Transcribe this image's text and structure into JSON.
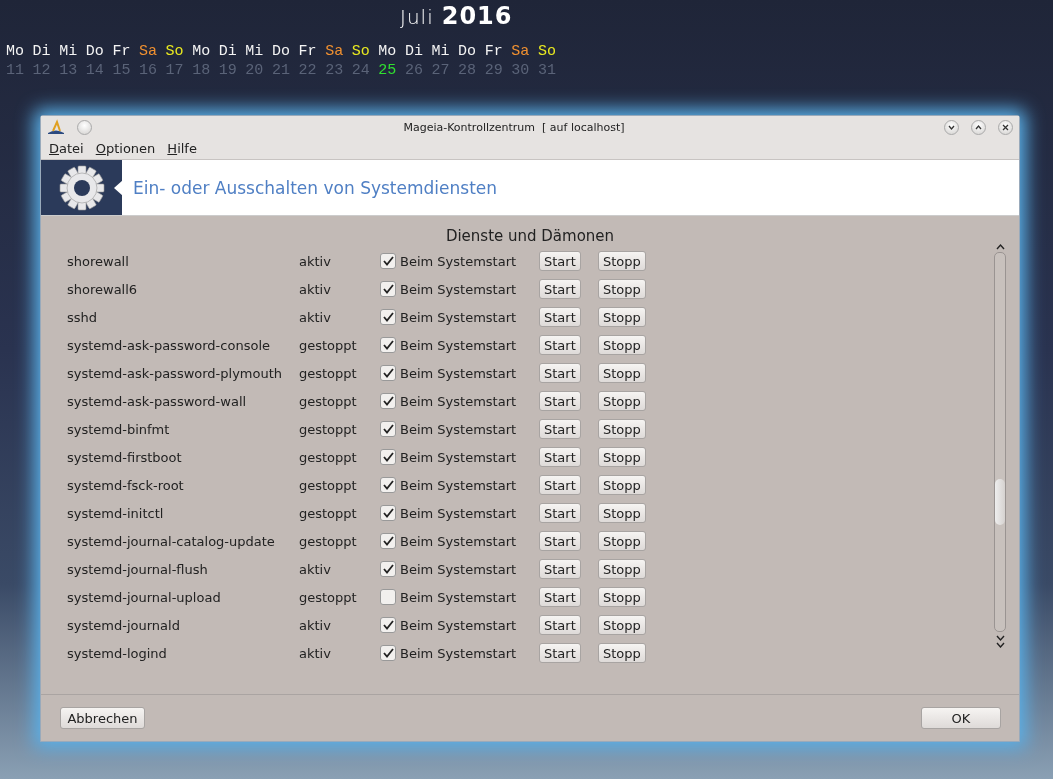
{
  "calendar": {
    "month": "Juli",
    "year": "2016",
    "days": [
      {
        "weekday": "Mo",
        "date": "11",
        "kind": "weekday",
        "today": false
      },
      {
        "weekday": "Di",
        "date": "12",
        "kind": "weekday",
        "today": false
      },
      {
        "weekday": "Mi",
        "date": "13",
        "kind": "weekday",
        "today": false
      },
      {
        "weekday": "Do",
        "date": "14",
        "kind": "weekday",
        "today": false
      },
      {
        "weekday": "Fr",
        "date": "15",
        "kind": "weekday",
        "today": false
      },
      {
        "weekday": "Sa",
        "date": "16",
        "kind": "saturday",
        "today": false
      },
      {
        "weekday": "So",
        "date": "17",
        "kind": "sunday",
        "today": false
      },
      {
        "weekday": "Mo",
        "date": "18",
        "kind": "weekday",
        "today": false
      },
      {
        "weekday": "Di",
        "date": "19",
        "kind": "weekday",
        "today": false
      },
      {
        "weekday": "Mi",
        "date": "20",
        "kind": "weekday",
        "today": false
      },
      {
        "weekday": "Do",
        "date": "21",
        "kind": "weekday",
        "today": false
      },
      {
        "weekday": "Fr",
        "date": "22",
        "kind": "weekday",
        "today": false
      },
      {
        "weekday": "Sa",
        "date": "23",
        "kind": "saturday",
        "today": false
      },
      {
        "weekday": "So",
        "date": "24",
        "kind": "sunday",
        "today": false
      },
      {
        "weekday": "Mo",
        "date": "25",
        "kind": "weekday",
        "today": true
      },
      {
        "weekday": "Di",
        "date": "26",
        "kind": "weekday",
        "today": false
      },
      {
        "weekday": "Mi",
        "date": "27",
        "kind": "weekday",
        "today": false
      },
      {
        "weekday": "Do",
        "date": "28",
        "kind": "weekday",
        "today": false
      },
      {
        "weekday": "Fr",
        "date": "29",
        "kind": "weekday",
        "today": false
      },
      {
        "weekday": "Sa",
        "date": "30",
        "kind": "saturday",
        "today": false
      },
      {
        "weekday": "So",
        "date": "31",
        "kind": "sunday",
        "today": false
      }
    ]
  },
  "window": {
    "title": "Mageia-Kontrollzentrum  [ auf localhost]",
    "menu": [
      {
        "label": "Datei"
      },
      {
        "label": "Optionen"
      },
      {
        "label": "Hilfe"
      }
    ],
    "banner": {
      "title": "Ein- oder Ausschalten von Systemdiensten"
    },
    "section_title": "Dienste und Dämonen",
    "services": [
      {
        "name": "shorewall",
        "status": "aktiv",
        "on_boot": true,
        "boot_label": "Beim Systemstart",
        "start_label": "Start",
        "stop_label": "Stopp"
      },
      {
        "name": "shorewall6",
        "status": "aktiv",
        "on_boot": true,
        "boot_label": "Beim Systemstart",
        "start_label": "Start",
        "stop_label": "Stopp"
      },
      {
        "name": "sshd",
        "status": "aktiv",
        "on_boot": true,
        "boot_label": "Beim Systemstart",
        "start_label": "Start",
        "stop_label": "Stopp"
      },
      {
        "name": "systemd-ask-password-console",
        "status": "gestoppt",
        "on_boot": true,
        "boot_label": "Beim Systemstart",
        "start_label": "Start",
        "stop_label": "Stopp"
      },
      {
        "name": "systemd-ask-password-plymouth",
        "status": "gestoppt",
        "on_boot": true,
        "boot_label": "Beim Systemstart",
        "start_label": "Start",
        "stop_label": "Stopp"
      },
      {
        "name": "systemd-ask-password-wall",
        "status": "gestoppt",
        "on_boot": true,
        "boot_label": "Beim Systemstart",
        "start_label": "Start",
        "stop_label": "Stopp"
      },
      {
        "name": "systemd-binfmt",
        "status": "gestoppt",
        "on_boot": true,
        "boot_label": "Beim Systemstart",
        "start_label": "Start",
        "stop_label": "Stopp"
      },
      {
        "name": "systemd-firstboot",
        "status": "gestoppt",
        "on_boot": true,
        "boot_label": "Beim Systemstart",
        "start_label": "Start",
        "stop_label": "Stopp"
      },
      {
        "name": "systemd-fsck-root",
        "status": "gestoppt",
        "on_boot": true,
        "boot_label": "Beim Systemstart",
        "start_label": "Start",
        "stop_label": "Stopp"
      },
      {
        "name": "systemd-initctl",
        "status": "gestoppt",
        "on_boot": true,
        "boot_label": "Beim Systemstart",
        "start_label": "Start",
        "stop_label": "Stopp"
      },
      {
        "name": "systemd-journal-catalog-update",
        "status": "gestoppt",
        "on_boot": true,
        "boot_label": "Beim Systemstart",
        "start_label": "Start",
        "stop_label": "Stopp"
      },
      {
        "name": "systemd-journal-flush",
        "status": "aktiv",
        "on_boot": true,
        "boot_label": "Beim Systemstart",
        "start_label": "Start",
        "stop_label": "Stopp"
      },
      {
        "name": "systemd-journal-upload",
        "status": "gestoppt",
        "on_boot": false,
        "boot_label": "Beim Systemstart",
        "start_label": "Start",
        "stop_label": "Stopp"
      },
      {
        "name": "systemd-journald",
        "status": "aktiv",
        "on_boot": true,
        "boot_label": "Beim Systemstart",
        "start_label": "Start",
        "stop_label": "Stopp"
      },
      {
        "name": "systemd-logind",
        "status": "aktiv",
        "on_boot": true,
        "boot_label": "Beim Systemstart",
        "start_label": "Start",
        "stop_label": "Stopp"
      }
    ],
    "cancel": "Abbrechen",
    "ok": "OK"
  }
}
